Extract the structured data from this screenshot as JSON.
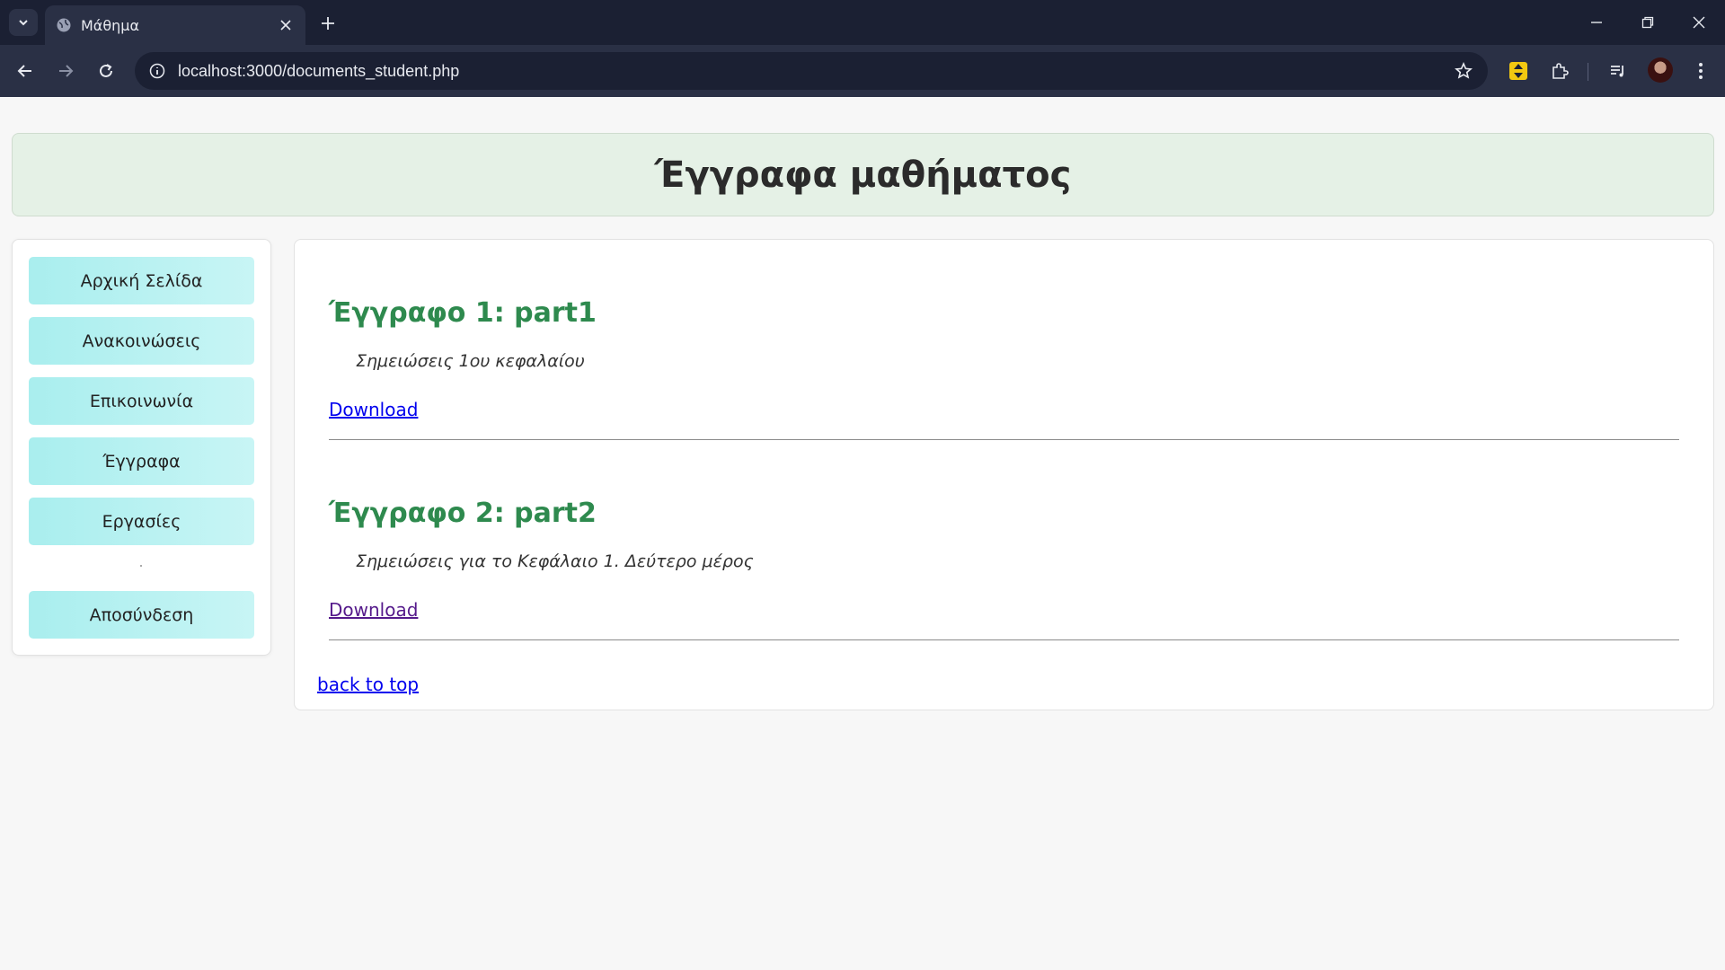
{
  "browser": {
    "tab_title": "Μάθημα",
    "url": "localhost:3000/documents_student.php"
  },
  "page": {
    "title": "Έγγραφα μαθήματος"
  },
  "sidebar": {
    "items": [
      {
        "label": "Αρχική Σελίδα"
      },
      {
        "label": "Ανακοινώσεις"
      },
      {
        "label": "Επικοινωνία"
      },
      {
        "label": "Έγγραφα"
      },
      {
        "label": "Εργασίες"
      },
      {
        "label": "Αποσύνδεση"
      }
    ]
  },
  "documents": [
    {
      "title": "Έγγραφο 1: part1",
      "description": "Σημειώσεις 1ου κεφαλαίου",
      "link_label": "Download"
    },
    {
      "title": "Έγγραφο 2: part2",
      "description": "Σημειώσεις για το Κεφάλαιο 1. Δεύτερο μέρος",
      "link_label": "Download"
    }
  ],
  "back_to_top": "back to top"
}
